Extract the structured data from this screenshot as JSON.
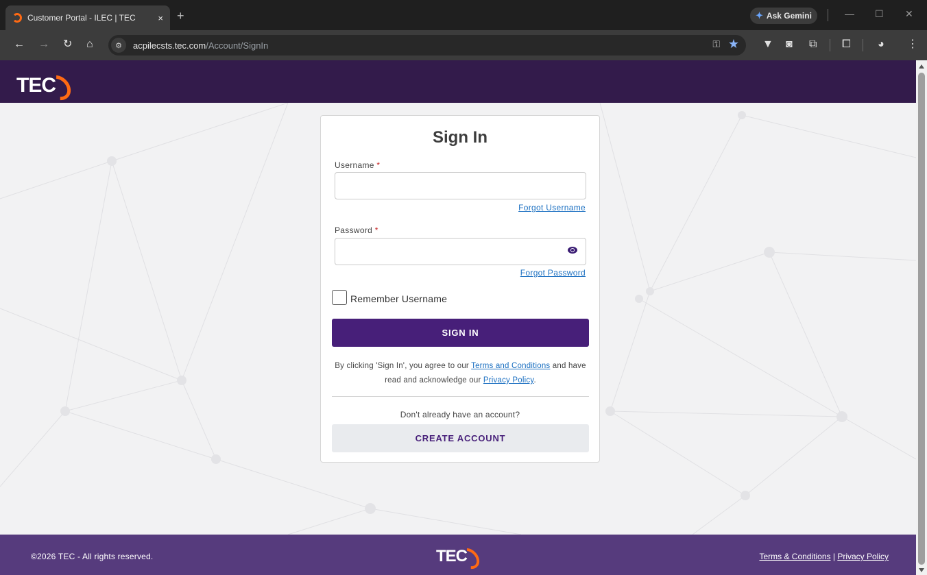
{
  "browser": {
    "tab_title": "Customer Portal - ILEC | TEC",
    "tab_close": "×",
    "new_tab": "+",
    "gemini_label": "Ask Gemini",
    "url_host": "acpilecsts.tec.com",
    "url_path": "/Account/SignIn"
  },
  "header": {
    "logo_text": "TEC"
  },
  "signin": {
    "title": "Sign In",
    "username_label": "Username",
    "password_label": "Password",
    "required_mark": "*",
    "forgot_username": "Forgot Username",
    "forgot_password": "Forgot Password",
    "remember_label": "Remember Username",
    "signin_button": "SIGN IN",
    "terms_prefix": "By clicking 'Sign In', you agree to our",
    "terms_link": "Terms and Conditions",
    "terms_mid": "and have read and acknowledge our",
    "privacy_link": "Privacy Policy",
    "terms_suffix": ".",
    "no_account": "Don't already have an account?",
    "create_button": "CREATE ACCOUNT"
  },
  "footer": {
    "copyright": "©2026  TEC - All rights reserved.",
    "logo_text": "TEC",
    "terms": "Terms & Conditions",
    "separator": "|",
    "privacy": "Privacy Policy"
  },
  "colors": {
    "header_bg": "#331b4b",
    "footer_bg": "#563b7d",
    "primary_button": "#471f79",
    "logo_accent": "#ff6a13",
    "link": "#1a6fc1"
  }
}
